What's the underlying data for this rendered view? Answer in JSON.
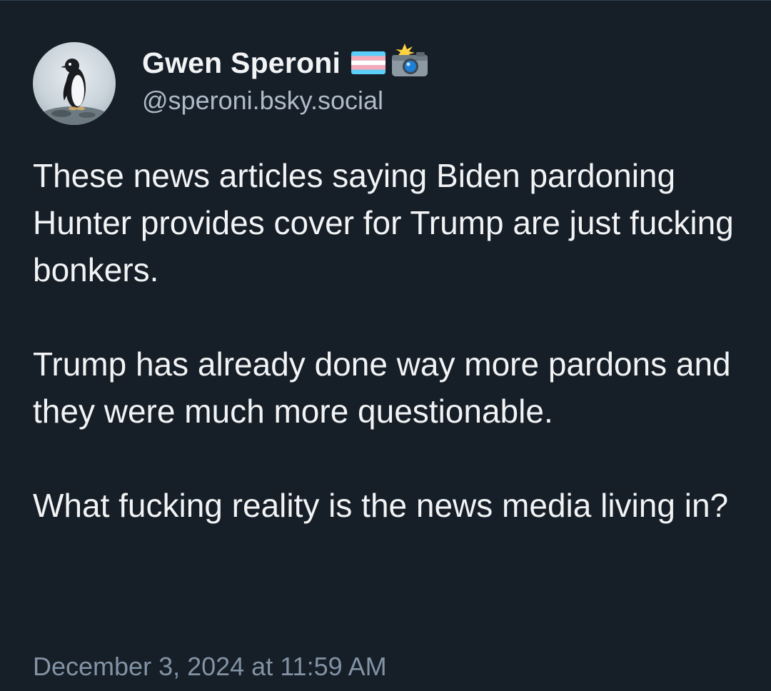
{
  "author": {
    "display_name": "Gwen Speroni",
    "handle": "@speroni.bsky.social",
    "avatar_icon": "penguin-avatar",
    "name_emojis": [
      "transgender-flag-icon",
      "camera-with-flash-icon"
    ]
  },
  "post": {
    "paragraphs": [
      "These news articles saying Biden pardoning Hunter provides cover for Trump are just fucking bonkers.",
      "Trump has already done way more pardons and they were much more questionable.",
      "What fucking reality is the news media living in?"
    ],
    "timestamp": "December 3, 2024 at 11:59 AM"
  },
  "colors": {
    "background": "#161e27",
    "text": "#f1f3f5",
    "handle": "#aebbc9",
    "timestamp": "#8293a5"
  }
}
